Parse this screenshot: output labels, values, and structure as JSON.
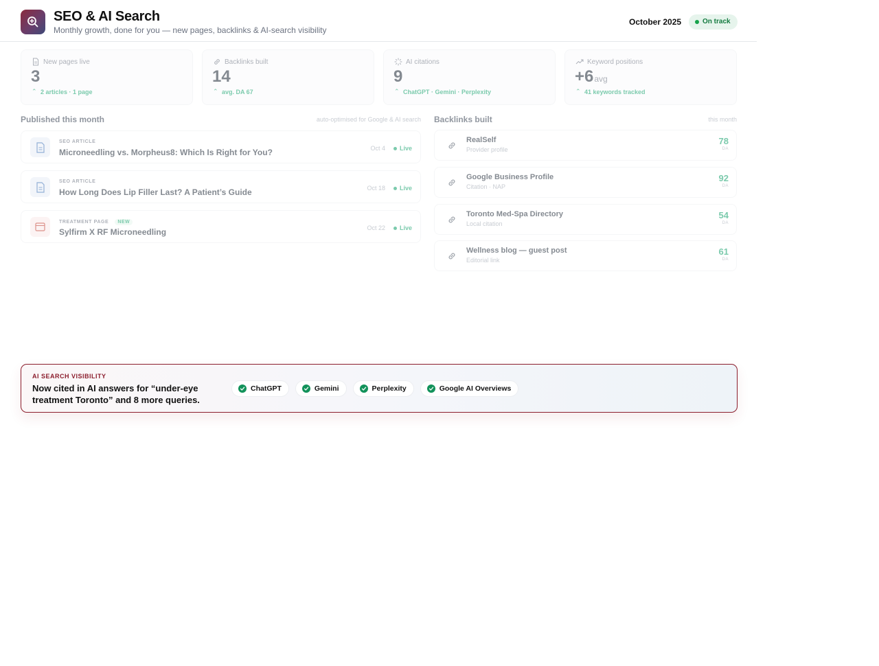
{
  "header": {
    "title": "SEO & AI Search",
    "subtitle": "Monthly growth, done for you — new pages, backlinks & AI-search visibility",
    "date": "October 2025",
    "status": "On track",
    "logo_icon": "search-plus-icon"
  },
  "stats": [
    {
      "label": "New pages live",
      "value": "3",
      "unit": "",
      "note": "2 articles · 1 page",
      "icon": "document-icon"
    },
    {
      "label": "Backlinks built",
      "value": "14",
      "unit": "",
      "note": "avg. DA 67",
      "icon": "link-icon"
    },
    {
      "label": "AI citations",
      "value": "9",
      "unit": "",
      "note": "ChatGPT · Gemini · Perplexity",
      "icon": "sparkle-icon"
    },
    {
      "label": "Keyword positions",
      "value": "+6",
      "unit": "avg",
      "note": "41 keywords tracked",
      "icon": "trend-up-icon"
    }
  ],
  "published": {
    "title": "Published this month",
    "aside": "auto-optimised for Google & AI search",
    "items": [
      {
        "kicker": "SEO ARTICLE",
        "badge": "",
        "title": "Microneedling vs. Morpheus8: Which Is Right for You?",
        "date": "Oct 4",
        "status": "Live",
        "icon": "document-icon"
      },
      {
        "kicker": "SEO ARTICLE",
        "badge": "",
        "title": "How Long Does Lip Filler Last? A Patient’s Guide",
        "date": "Oct 18",
        "status": "Live",
        "icon": "document-icon"
      },
      {
        "kicker": "TREATMENT PAGE",
        "badge": "NEW",
        "title": "Sylfirm X RF Microneedling",
        "date": "Oct 22",
        "status": "Live",
        "icon": "browser-window-icon"
      }
    ]
  },
  "backlinks": {
    "title": "Backlinks built",
    "aside": "this month",
    "da_label": "DA",
    "items": [
      {
        "name": "RealSelf",
        "type": "Provider profile",
        "da": "78"
      },
      {
        "name": "Google Business Profile",
        "type": "Citation · NAP",
        "da": "92"
      },
      {
        "name": "Toronto Med-Spa Directory",
        "type": "Local citation",
        "da": "54"
      },
      {
        "name": "Wellness blog — guest post",
        "type": "Editorial link",
        "da": "61"
      }
    ]
  },
  "ai_visibility": {
    "kicker": "AI SEARCH VISIBILITY",
    "headline": "Now cited in AI answers for “under-eye treatment Toronto” and 8 more queries.",
    "chips": [
      "ChatGPT",
      "Gemini",
      "Perplexity",
      "Google AI Overviews"
    ]
  },
  "colors": {
    "accent": "#8b1d2c",
    "positive": "#10a06a",
    "status_bg": "#e6f4ec"
  }
}
